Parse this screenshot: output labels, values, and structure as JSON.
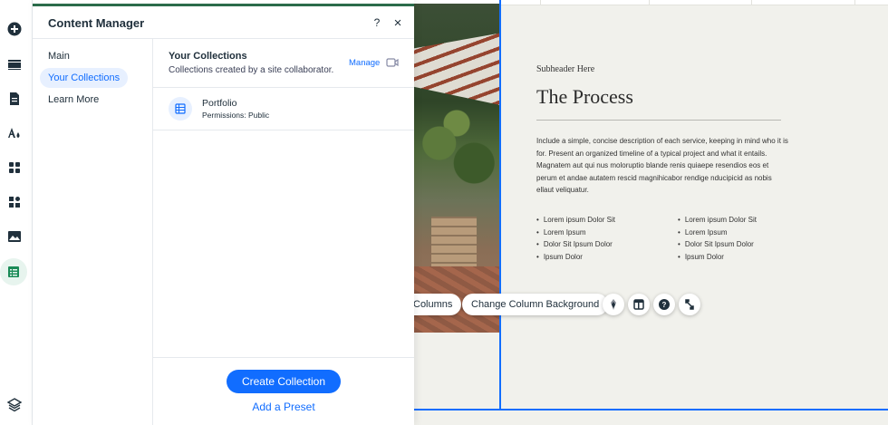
{
  "toolbar": {
    "items": [
      {
        "name": "add-elements",
        "icon": "plus-circle-icon"
      },
      {
        "name": "add-section",
        "icon": "sections-icon"
      },
      {
        "name": "pages",
        "icon": "page-icon"
      },
      {
        "name": "site-design",
        "icon": "design-icon"
      },
      {
        "name": "add-apps",
        "icon": "apps-icon"
      },
      {
        "name": "app-market",
        "icon": "puzzle-icon"
      },
      {
        "name": "media",
        "icon": "image-icon"
      },
      {
        "name": "cms",
        "icon": "table-icon",
        "active": true
      },
      {
        "name": "layers",
        "icon": "layers-icon"
      }
    ]
  },
  "panel": {
    "title": "Content Manager",
    "help_icon": "?",
    "close_icon": "×",
    "accent_color": "#2b6c4b",
    "nav": [
      {
        "label": "Main",
        "active": false
      },
      {
        "label": "Your Collections",
        "active": true
      },
      {
        "label": "Learn More",
        "active": false
      }
    ],
    "collections_title": "Your Collections",
    "collections_subtitle": "Collections created by a site collaborator.",
    "manage_label": "Manage",
    "collections": [
      {
        "name": "Portfolio",
        "permissions": "Permissions: Public"
      }
    ],
    "create_button": "Create Collection",
    "preset_link": "Add a Preset"
  },
  "canvas": {
    "subheader": "Subheader Here",
    "title": "The Process",
    "description": "Include a simple, concise description of each service, keeping in mind who it is for. Present an organized timeline of a typical project and what it entails. Magnatem aut qui nus moloruptio blande renis quiaepe resendios eos et perum et andae autatem rescid magnihicabor rendige nducipicid as nobis ellaut veliquatur.",
    "bullets_left": [
      "Lorem ipsum Dolor Sit",
      "Lorem Ipsum",
      "Dolor Sit Ipsum Dolor",
      "Ipsum Dolor"
    ],
    "bullets_right": [
      "Lorem ipsum Dolor Sit",
      "Lorem Ipsum",
      "Dolor Sit Ipsum Dolor",
      "Ipsum Dolor"
    ],
    "selection_color": "#116dff"
  },
  "action_bar": {
    "columns_label": "Columns",
    "change_bg_label": "Change Column Background",
    "icons": [
      "animation-icon",
      "layout-icon",
      "help-icon",
      "stretch-icon"
    ]
  }
}
